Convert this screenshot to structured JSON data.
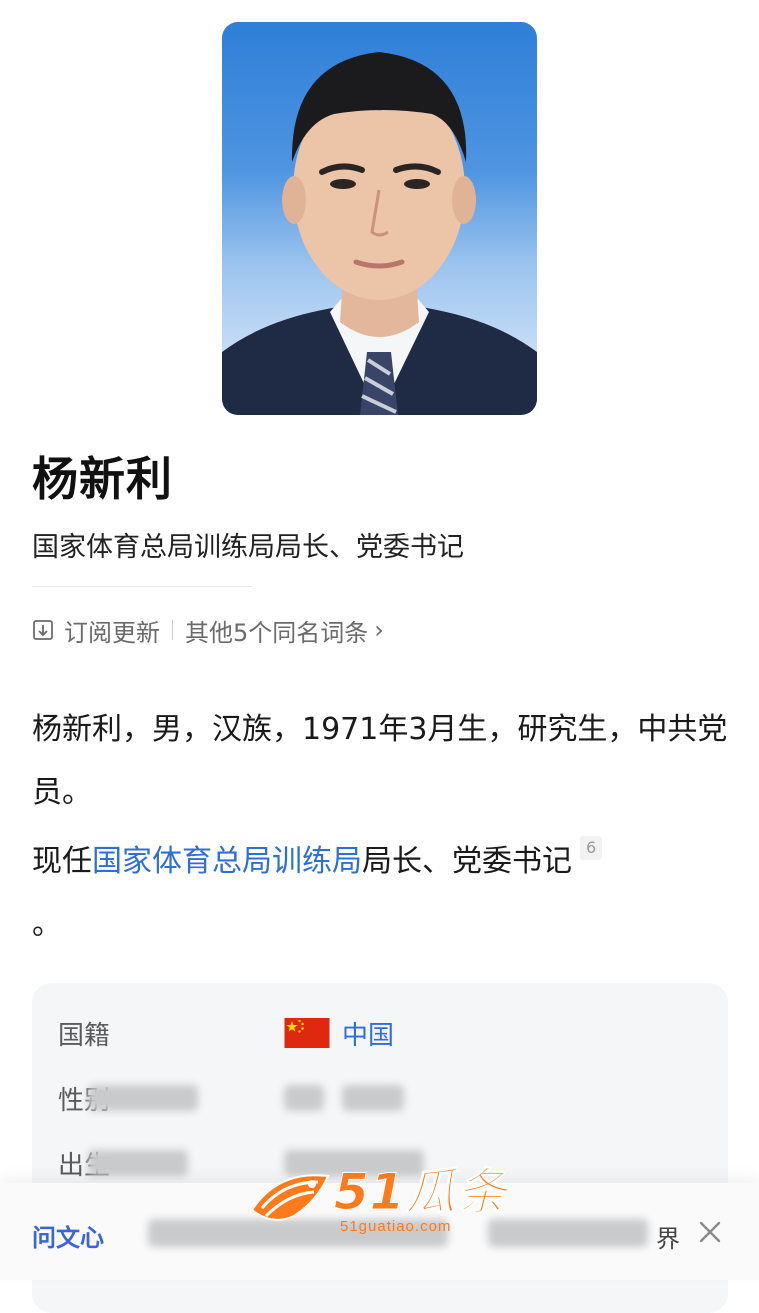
{
  "entry": {
    "name": "杨新利",
    "subtitle": "国家体育总局训练局局长、党委书记"
  },
  "meta": {
    "subscribe_label": "订阅更新",
    "homonyms_label": "其他5个同名词条"
  },
  "summary": {
    "p1": "杨新利，男，汉族，1971年3月生，研究生，中共党员。",
    "p2_prefix": "现任",
    "p2_link": "国家体育总局训练局",
    "p2_suffix": "局长、党委书记",
    "p2_ref": "6",
    "p2_trailing": "。"
  },
  "infobox": {
    "nationality_label": "国籍",
    "nationality_value": "中国",
    "gender_label_partial": "性别",
    "birth_label_partial": "出生"
  },
  "bottom_bar": {
    "ask_label": "问文心",
    "end_text_partial": "界"
  },
  "watermark": {
    "brand": "51瓜条",
    "url": "51guatiao.com"
  },
  "colors": {
    "link": "#2e6fd6",
    "ask_label": "#3a64d8",
    "watermark": "#ff7a1a",
    "flag_red": "#de2910",
    "flag_star": "#ffde00"
  }
}
